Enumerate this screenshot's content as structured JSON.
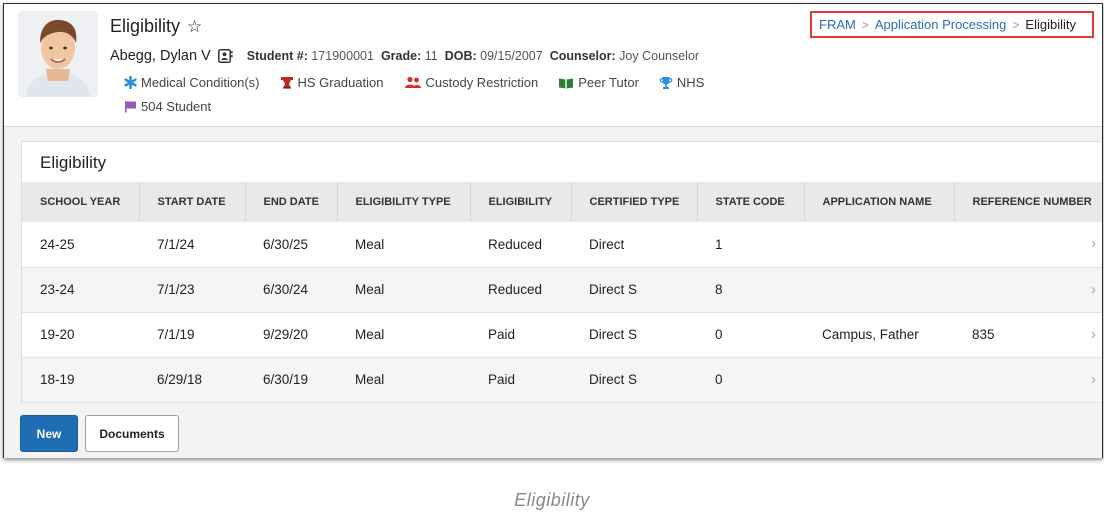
{
  "header": {
    "title": "Eligibility",
    "student_name": "Abegg, Dylan V",
    "student_number_label": "Student #:",
    "student_number": "171900001",
    "grade_label": "Grade:",
    "grade": "11",
    "dob_label": "DOB:",
    "dob": "09/15/2007",
    "counselor_label": "Counselor:",
    "counselor": "Joy Counselor",
    "flags": [
      {
        "icon": "medical-asterisk-icon",
        "label": "Medical Condition(s)",
        "color": "#2b8fdd"
      },
      {
        "icon": "graduation-cap-icon",
        "label": "HS Graduation",
        "color": "#c62828"
      },
      {
        "icon": "custody-people-icon",
        "label": "Custody Restriction",
        "color": "#d32f2f"
      },
      {
        "icon": "open-book-icon",
        "label": "Peer Tutor",
        "color": "#2e7d32"
      },
      {
        "icon": "trophy-icon",
        "label": "NHS",
        "color": "#2b8fdd"
      },
      {
        "icon": "flag-icon",
        "label": "504 Student",
        "color": "#9b59b6"
      }
    ]
  },
  "breadcrumb": {
    "items": [
      "FRAM",
      "Application Processing",
      "Eligibility"
    ]
  },
  "panel": {
    "title": "Eligibility",
    "columns": [
      "SCHOOL YEAR",
      "START DATE",
      "END DATE",
      "ELIGIBILITY TYPE",
      "ELIGIBILITY",
      "CERTIFIED TYPE",
      "STATE CODE",
      "APPLICATION NAME",
      "REFERENCE NUMBER"
    ],
    "rows": [
      [
        "24-25",
        "7/1/24",
        "6/30/25",
        "Meal",
        "Reduced",
        "Direct",
        "1",
        "",
        ""
      ],
      [
        "23-24",
        "7/1/23",
        "6/30/24",
        "Meal",
        "Reduced",
        "Direct S",
        "8",
        "",
        ""
      ],
      [
        "19-20",
        "7/1/19",
        "9/29/20",
        "Meal",
        "Paid",
        "Direct S",
        "0",
        "Campus, Father",
        "835"
      ],
      [
        "18-19",
        "6/29/18",
        "6/30/19",
        "Meal",
        "Paid",
        "Direct S",
        "0",
        "",
        ""
      ]
    ]
  },
  "footer": {
    "new_label": "New",
    "documents_label": "Documents"
  },
  "caption": "Eligibility",
  "colors": {
    "accent": "#1f6db3",
    "link": "#2a6fb5",
    "highlight_border": "#e03a3a"
  }
}
